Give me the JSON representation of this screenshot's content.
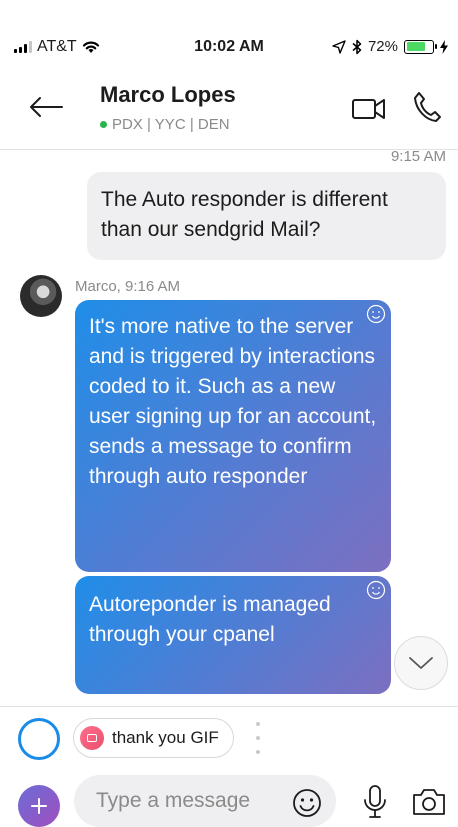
{
  "status_bar": {
    "carrier": "AT&T",
    "time": "10:02 AM",
    "battery": "72%",
    "battery_level": 0.72
  },
  "header": {
    "name": "Marco Lopes",
    "status": "PDX | YYC | DEN"
  },
  "messages": {
    "timestamp": "9:15 AM",
    "sent": "The Auto responder is different than our sendgrid Mail?",
    "sender_line": "Marco, 9:16 AM",
    "received_1": "It's more native to the server and is triggered by interactions coded to it. Such as a new user signing up for an account, sends a message to confirm through auto responder",
    "received_2": "Autoreponder is managed through your cpanel"
  },
  "suggestions": {
    "chip_label": "thank you GIF"
  },
  "composer": {
    "placeholder": "Type a message"
  },
  "colors": {
    "accent": "#1b8be8",
    "online": "#2ab54c",
    "bubble_gradient_start": "#1f8ee8",
    "bubble_gradient_end": "#7d6fc0",
    "sent_bubble": "#efeff1"
  },
  "icons": {
    "back": "arrow-left-icon",
    "video": "video-camera-icon",
    "call": "phone-icon",
    "react": "smiley-icon",
    "scroll_down": "chevron-down-icon",
    "plus": "plus-icon",
    "emoji": "emoji-icon",
    "mic": "microphone-icon",
    "camera": "camera-icon"
  }
}
